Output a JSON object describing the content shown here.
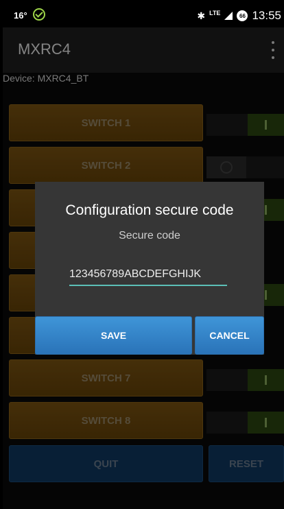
{
  "status": {
    "left_text": "16°",
    "lte": "LTE",
    "battery": "66",
    "time": "13:55"
  },
  "app": {
    "title": "MXRC4"
  },
  "device_label": "Device: MXRC4_BT",
  "switches": [
    {
      "label": "SWITCH 1",
      "state": "on"
    },
    {
      "label": "SWITCH 2",
      "state": "off"
    },
    {
      "label": "",
      "state": "on"
    },
    {
      "label": "",
      "state": "unknown"
    },
    {
      "label": "",
      "state": "on"
    },
    {
      "label": "",
      "state": "unknown"
    },
    {
      "label": "SWITCH 7",
      "state": "on"
    },
    {
      "label": "SWITCH 8",
      "state": "on"
    }
  ],
  "bottom": {
    "quit": "QUIT",
    "reset": "RESET"
  },
  "dialog": {
    "title": "Configuration secure code",
    "field_label": "Secure code",
    "value": "123456789ABCDEFGHIJK",
    "save": "SAVE",
    "cancel": "CANCEL"
  },
  "colors": {
    "switch_button": "#6e4a0c",
    "quit_button": "#0f3a63",
    "dialog_button": "#3387c9",
    "input_underline": "#5cc0b8"
  }
}
